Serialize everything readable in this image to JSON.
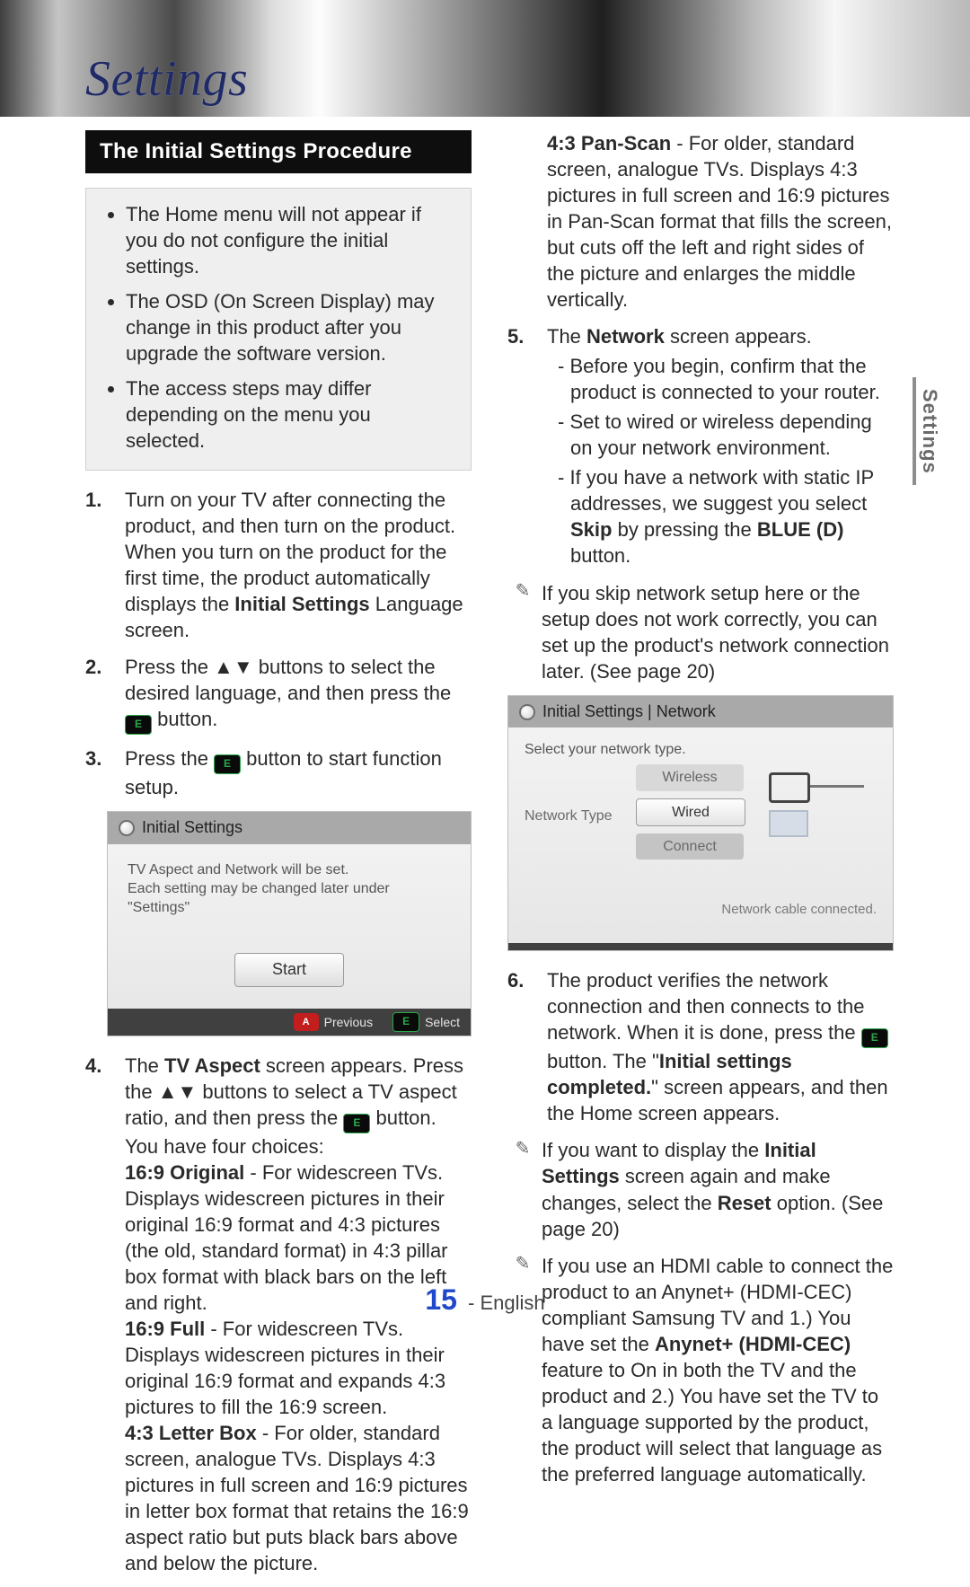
{
  "header": {
    "page_title": "Settings"
  },
  "sidetab": {
    "label": "Settings"
  },
  "section_bar": "The Initial Settings Procedure",
  "intro": {
    "items": [
      "The Home menu will not appear if you do not configure the initial settings.",
      "The OSD (On Screen Display) may change in this product after you upgrade the software version.",
      "The access steps may differ depending on the menu you selected."
    ]
  },
  "left": {
    "step1": {
      "num": "1.",
      "text_a": "Turn on your TV after connecting the product, and then turn on the product. When you turn on the product for the first time, the product automatically displays the ",
      "text_bold1": "Initial Settings",
      "text_b": " Language screen."
    },
    "step2": {
      "num": "2.",
      "text_a": "Press the ",
      "arrows": "▲▼",
      "text_b": " buttons to select the desired language, and then press the ",
      "enter": "E",
      "text_c": " button."
    },
    "step3": {
      "num": "3.",
      "text_a": "Press the ",
      "enter": "E",
      "text_b": " button to start function setup."
    },
    "osd": {
      "title": "Initial Settings",
      "line1": "TV Aspect and Network will be set.",
      "line2": "Each setting may be changed later under \"Settings\"",
      "start": "Start",
      "prev_key": "A",
      "prev_label": "Previous",
      "sel_key": "E",
      "sel_label": "Select"
    },
    "step4": {
      "num": "4.",
      "lead_a": "The ",
      "lead_bold": "TV Aspect",
      "lead_b": " screen appears. Press the ",
      "arrows": "▲▼",
      "lead_c": " buttons to select a TV aspect ratio, and then press the ",
      "enter": "E",
      "lead_d": " button.",
      "choices_intro": "You have four choices:",
      "a169o_t": "16:9 Original",
      "a169o_b": " - For widescreen TVs. Displays widescreen pictures in their original 16:9 format and 4:3 pictures (the old, standard format) in 4:3 pillar box format with black bars on the left and right.",
      "a169f_t": "16:9 Full",
      "a169f_b": " - For widescreen TVs. Displays widescreen pictures in their original 16:9 format and expands 4:3 pictures to fill the 16:9 screen.",
      "a43l_t": "4:3 Letter Box",
      "a43l_b": " - For older, standard screen, analogue TVs. Displays 4:3 pictures in full screen and 16:9 pictures in letter box format that retains the 16:9 aspect ratio but puts black bars above and below the picture."
    }
  },
  "right": {
    "a43p_t": "4:3 Pan-Scan",
    "a43p_b": " - For older, standard screen, analogue TVs. Displays 4:3 pictures in full screen and 16:9 pictures in Pan-Scan format that fills the screen, but cuts off the left and right sides of the picture and enlarges the middle vertically.",
    "step5": {
      "num": "5.",
      "text_a": "The ",
      "bold": "Network",
      "text_b": " screen appears.",
      "d1": "Before you begin, confirm that the product is connected to your router.",
      "d2": "Set to wired or wireless depending on your network environment.",
      "d3_a": "If you have a network with static IP addresses, we suggest you select ",
      "d3_bold1": "Skip",
      "d3_b": " by pressing the ",
      "d3_bold2": "BLUE (D)",
      "d3_c": " button."
    },
    "note1": "If you skip network setup here or the setup does not work correctly, you can set up the product's network connection later. (See page 20)",
    "osd": {
      "title": "Initial Settings | Network",
      "prompt": "Select your network type.",
      "label": "Network Type",
      "opt_wireless": "Wireless",
      "opt_wired": "Wired",
      "opt_connect": "Connect",
      "status": "Network cable connected."
    },
    "step6": {
      "num": "6.",
      "text_a": "The product verifies the network connection and then connects to the network. When it is done, press the ",
      "enter": "E",
      "text_b": " button. The \"",
      "bold": "Initial settings completed.",
      "text_c": "\" screen appears, and then the Home screen appears."
    },
    "note2_a": "If you want to display the ",
    "note2_bold1": "Initial Settings",
    "note2_b": " screen again and make changes, select the ",
    "note2_bold2": "Reset",
    "note2_c": " option. (See page 20)",
    "note3_a": "If you use an HDMI cable to connect the product to an Anynet+ (HDMI-CEC) compliant Samsung TV and 1.) You have set the ",
    "note3_bold1": "Anynet+ (HDMI-CEC)",
    "note3_b": " feature to On in both the TV and the product and 2.) You have set the TV to a language supported by the product, the product will select that language as the preferred language automatically."
  },
  "footer": {
    "page_no": "15",
    "lang": "English"
  }
}
